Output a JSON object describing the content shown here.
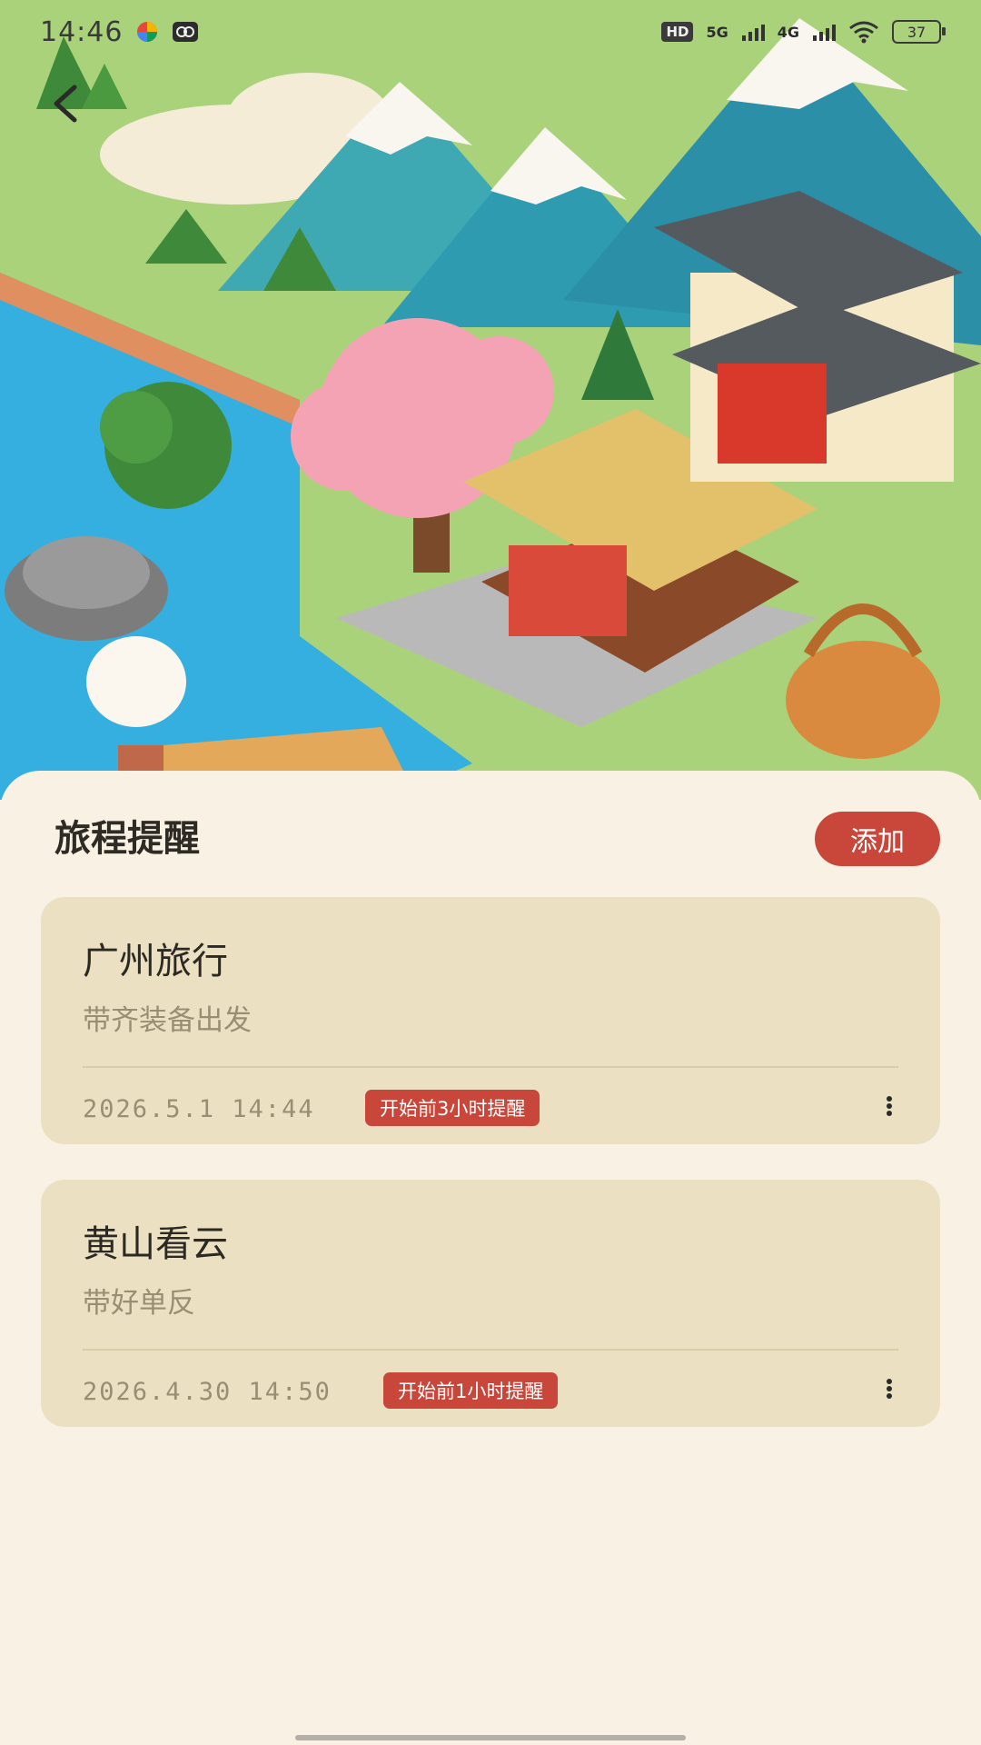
{
  "status_bar": {
    "time": "14:46",
    "hd_label": "HD",
    "net_5g": "5G",
    "net_4g": "4G",
    "battery": "37"
  },
  "section": {
    "title": "旅程提醒",
    "add_label": "添加"
  },
  "trips": [
    {
      "title": "广州旅行",
      "desc": "带齐装备出发",
      "date": "2026.5.1 14:44",
      "badge": "开始前3小时提醒"
    },
    {
      "title": "黄山看云",
      "desc": "带好单反",
      "date": "2026.4.30 14:50",
      "badge": "开始前1小时提醒"
    }
  ],
  "colors": {
    "accent": "#c8473a",
    "card_bg": "#ebe1c2",
    "page_bg": "#f8f1e4"
  },
  "icons": {
    "back": "chevron-left-icon",
    "more": "more-vertical-icon"
  }
}
